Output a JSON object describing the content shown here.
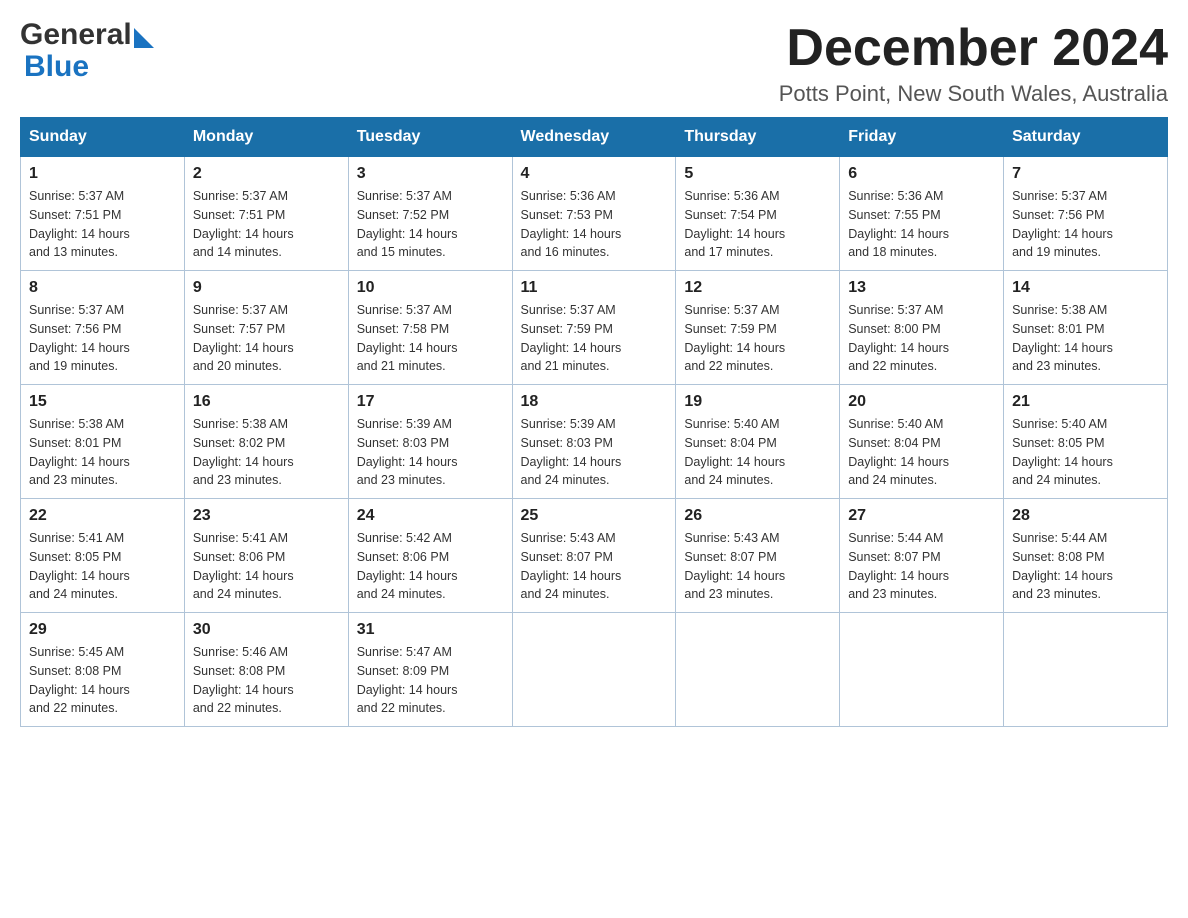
{
  "header": {
    "logo_general": "General",
    "logo_blue": "Blue",
    "month_title": "December 2024",
    "location": "Potts Point, New South Wales, Australia"
  },
  "days_of_week": [
    "Sunday",
    "Monday",
    "Tuesday",
    "Wednesday",
    "Thursday",
    "Friday",
    "Saturday"
  ],
  "weeks": [
    [
      {
        "day": "1",
        "sunrise": "5:37 AM",
        "sunset": "7:51 PM",
        "daylight": "14 hours and 13 minutes."
      },
      {
        "day": "2",
        "sunrise": "5:37 AM",
        "sunset": "7:51 PM",
        "daylight": "14 hours and 14 minutes."
      },
      {
        "day": "3",
        "sunrise": "5:37 AM",
        "sunset": "7:52 PM",
        "daylight": "14 hours and 15 minutes."
      },
      {
        "day": "4",
        "sunrise": "5:36 AM",
        "sunset": "7:53 PM",
        "daylight": "14 hours and 16 minutes."
      },
      {
        "day": "5",
        "sunrise": "5:36 AM",
        "sunset": "7:54 PM",
        "daylight": "14 hours and 17 minutes."
      },
      {
        "day": "6",
        "sunrise": "5:36 AM",
        "sunset": "7:55 PM",
        "daylight": "14 hours and 18 minutes."
      },
      {
        "day": "7",
        "sunrise": "5:37 AM",
        "sunset": "7:56 PM",
        "daylight": "14 hours and 19 minutes."
      }
    ],
    [
      {
        "day": "8",
        "sunrise": "5:37 AM",
        "sunset": "7:56 PM",
        "daylight": "14 hours and 19 minutes."
      },
      {
        "day": "9",
        "sunrise": "5:37 AM",
        "sunset": "7:57 PM",
        "daylight": "14 hours and 20 minutes."
      },
      {
        "day": "10",
        "sunrise": "5:37 AM",
        "sunset": "7:58 PM",
        "daylight": "14 hours and 21 minutes."
      },
      {
        "day": "11",
        "sunrise": "5:37 AM",
        "sunset": "7:59 PM",
        "daylight": "14 hours and 21 minutes."
      },
      {
        "day": "12",
        "sunrise": "5:37 AM",
        "sunset": "7:59 PM",
        "daylight": "14 hours and 22 minutes."
      },
      {
        "day": "13",
        "sunrise": "5:37 AM",
        "sunset": "8:00 PM",
        "daylight": "14 hours and 22 minutes."
      },
      {
        "day": "14",
        "sunrise": "5:38 AM",
        "sunset": "8:01 PM",
        "daylight": "14 hours and 23 minutes."
      }
    ],
    [
      {
        "day": "15",
        "sunrise": "5:38 AM",
        "sunset": "8:01 PM",
        "daylight": "14 hours and 23 minutes."
      },
      {
        "day": "16",
        "sunrise": "5:38 AM",
        "sunset": "8:02 PM",
        "daylight": "14 hours and 23 minutes."
      },
      {
        "day": "17",
        "sunrise": "5:39 AM",
        "sunset": "8:03 PM",
        "daylight": "14 hours and 23 minutes."
      },
      {
        "day": "18",
        "sunrise": "5:39 AM",
        "sunset": "8:03 PM",
        "daylight": "14 hours and 24 minutes."
      },
      {
        "day": "19",
        "sunrise": "5:40 AM",
        "sunset": "8:04 PM",
        "daylight": "14 hours and 24 minutes."
      },
      {
        "day": "20",
        "sunrise": "5:40 AM",
        "sunset": "8:04 PM",
        "daylight": "14 hours and 24 minutes."
      },
      {
        "day": "21",
        "sunrise": "5:40 AM",
        "sunset": "8:05 PM",
        "daylight": "14 hours and 24 minutes."
      }
    ],
    [
      {
        "day": "22",
        "sunrise": "5:41 AM",
        "sunset": "8:05 PM",
        "daylight": "14 hours and 24 minutes."
      },
      {
        "day": "23",
        "sunrise": "5:41 AM",
        "sunset": "8:06 PM",
        "daylight": "14 hours and 24 minutes."
      },
      {
        "day": "24",
        "sunrise": "5:42 AM",
        "sunset": "8:06 PM",
        "daylight": "14 hours and 24 minutes."
      },
      {
        "day": "25",
        "sunrise": "5:43 AM",
        "sunset": "8:07 PM",
        "daylight": "14 hours and 24 minutes."
      },
      {
        "day": "26",
        "sunrise": "5:43 AM",
        "sunset": "8:07 PM",
        "daylight": "14 hours and 23 minutes."
      },
      {
        "day": "27",
        "sunrise": "5:44 AM",
        "sunset": "8:07 PM",
        "daylight": "14 hours and 23 minutes."
      },
      {
        "day": "28",
        "sunrise": "5:44 AM",
        "sunset": "8:08 PM",
        "daylight": "14 hours and 23 minutes."
      }
    ],
    [
      {
        "day": "29",
        "sunrise": "5:45 AM",
        "sunset": "8:08 PM",
        "daylight": "14 hours and 22 minutes."
      },
      {
        "day": "30",
        "sunrise": "5:46 AM",
        "sunset": "8:08 PM",
        "daylight": "14 hours and 22 minutes."
      },
      {
        "day": "31",
        "sunrise": "5:47 AM",
        "sunset": "8:09 PM",
        "daylight": "14 hours and 22 minutes."
      },
      null,
      null,
      null,
      null
    ]
  ],
  "labels": {
    "sunrise": "Sunrise:",
    "sunset": "Sunset:",
    "daylight": "Daylight:"
  }
}
